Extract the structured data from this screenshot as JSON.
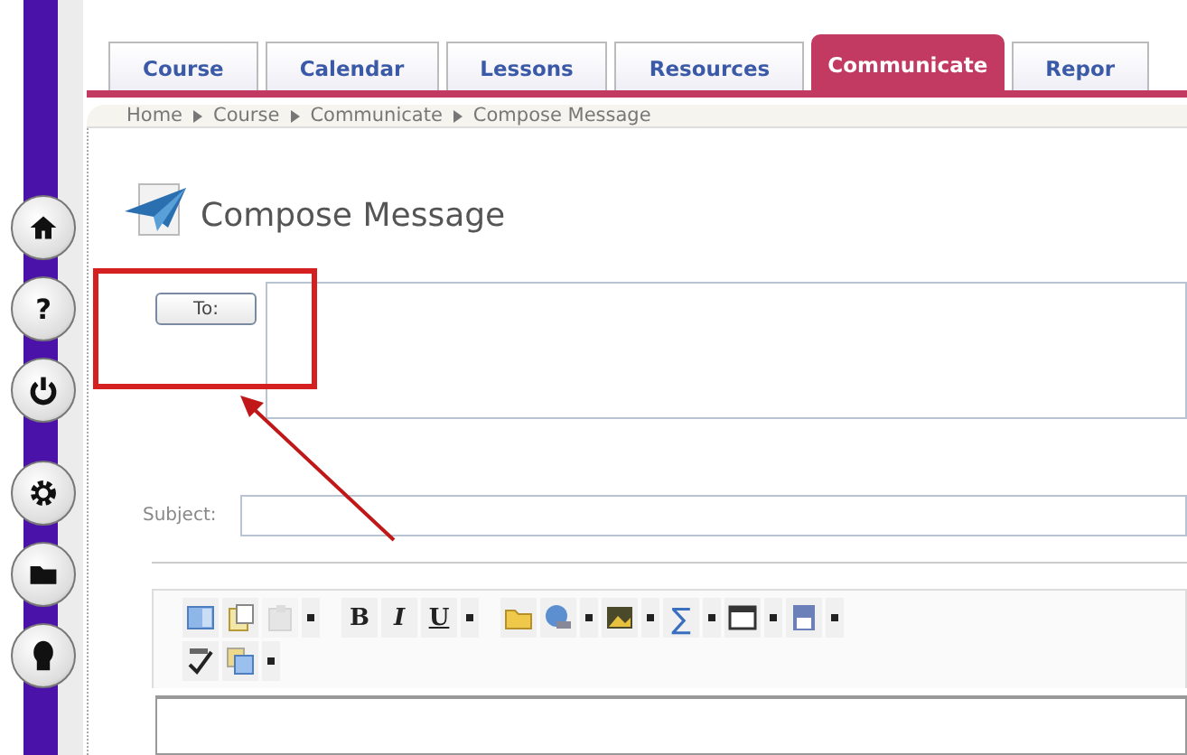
{
  "tabs": [
    {
      "label": "Course",
      "selected": false
    },
    {
      "label": "Calendar",
      "selected": false
    },
    {
      "label": "Lessons",
      "selected": false
    },
    {
      "label": "Resources",
      "selected": false
    },
    {
      "label": "Communicate",
      "selected": true
    },
    {
      "label": "Repor",
      "selected": false
    }
  ],
  "breadcrumb": [
    "Home",
    "Course",
    "Communicate",
    "Compose Message"
  ],
  "rail": [
    {
      "kind": "home"
    },
    {
      "kind": "help",
      "label": "?"
    },
    {
      "kind": "power"
    },
    {
      "kind": "gear"
    },
    {
      "kind": "folder"
    },
    {
      "kind": "person"
    }
  ],
  "page_title": "Compose Message",
  "to_button": "To:",
  "subject_label": "Subject:",
  "toolbar_rows": [
    [
      {
        "kind": "table"
      },
      {
        "kind": "paste"
      },
      {
        "kind": "clipboard",
        "disabled": true
      },
      {
        "kind": "caret"
      },
      {
        "kind": "gap"
      },
      {
        "kind": "bold",
        "label": "B"
      },
      {
        "kind": "italic",
        "label": "I"
      },
      {
        "kind": "underline",
        "label": "U"
      },
      {
        "kind": "caret"
      },
      {
        "kind": "gap"
      },
      {
        "kind": "folder"
      },
      {
        "kind": "globe"
      },
      {
        "kind": "caret"
      },
      {
        "kind": "image"
      },
      {
        "kind": "caret"
      },
      {
        "kind": "sum",
        "label": "∑"
      },
      {
        "kind": "caret"
      },
      {
        "kind": "window"
      },
      {
        "kind": "caret"
      },
      {
        "kind": "save"
      },
      {
        "kind": "caret"
      }
    ],
    [
      {
        "kind": "spell"
      },
      {
        "kind": "copy"
      },
      {
        "kind": "caret"
      }
    ]
  ],
  "annotation": {
    "kind": "box-and-arrow"
  }
}
